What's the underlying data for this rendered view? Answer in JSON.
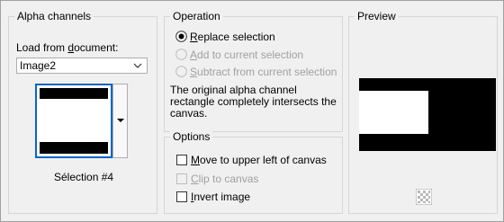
{
  "alpha_channels": {
    "group_title": "Alpha channels",
    "load_label": "Load from document:",
    "load_label_prefix": "Load from ",
    "load_label_underlined": "d",
    "load_label_suffix": "ocument:",
    "document_value": "Image2",
    "thumbnail_caption": "Sélection #4"
  },
  "operation": {
    "group_title": "Operation",
    "options": [
      {
        "label": "Replace selection",
        "ul": "R",
        "rest": "eplace selection",
        "selected": true,
        "enabled": true
      },
      {
        "label": "Add to current selection",
        "ul": "A",
        "rest": "dd to current selection",
        "selected": false,
        "enabled": false
      },
      {
        "label": "Subtract from current selection",
        "ul": "S",
        "rest": "ubtract from current selection",
        "selected": false,
        "enabled": false
      }
    ],
    "message": "The original alpha channel rectangle completely intersects the canvas."
  },
  "options": {
    "group_title": "Options",
    "items": [
      {
        "label": "Move to upper left of canvas",
        "ul": "M",
        "rest": "ove to upper left of canvas",
        "checked": false,
        "enabled": true
      },
      {
        "label": "Clip to canvas",
        "ul": "C",
        "rest": "lip to canvas",
        "checked": false,
        "enabled": false
      },
      {
        "label": "Invert image",
        "ul": "I",
        "rest": "nvert image",
        "checked": false,
        "enabled": true
      }
    ]
  },
  "preview": {
    "group_title": "Preview"
  }
}
